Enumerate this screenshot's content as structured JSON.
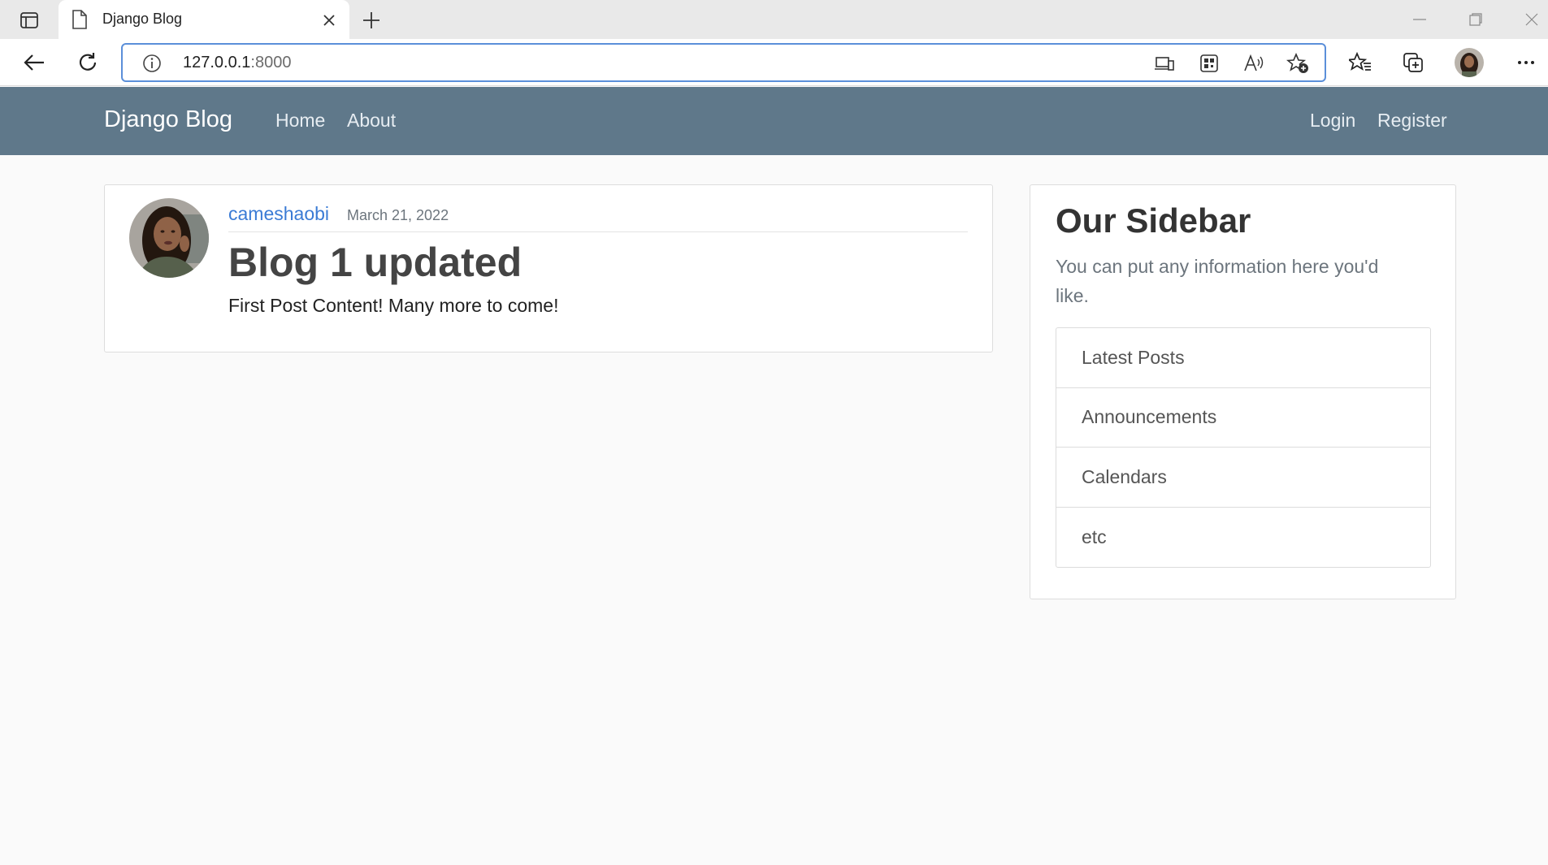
{
  "browser": {
    "tab_title": "Django Blog",
    "url_host": "127.0.0.1",
    "url_port": ":8000",
    "icons": {
      "sidebar": "tab-sidebar-icon",
      "page": "page-icon",
      "close": "close-icon",
      "new_tab": "plus-icon",
      "back": "back-arrow-icon",
      "reload": "reload-icon",
      "info": "info-icon",
      "app_available": "app-available-icon",
      "qr": "qr-code-icon",
      "read_aloud": "read-aloud-icon",
      "add_favorite": "add-favorite-icon",
      "favorites": "favorites-icon",
      "collections": "collections-icon",
      "menu": "more-menu-icon"
    },
    "accent": "#5b8fd9"
  },
  "navbar": {
    "brand": "Django Blog",
    "links_left": [
      "Home",
      "About"
    ],
    "links_right": [
      "Login",
      "Register"
    ],
    "background": "#5f788a"
  },
  "post": {
    "author": "cameshaobi",
    "date": "March 21, 2022",
    "title": "Blog 1 updated",
    "content": "First Post Content! Many more to come!",
    "author_color": "#3a7bd5"
  },
  "sidebar": {
    "title": "Our Sidebar",
    "text": "You can put any information here you'd like.",
    "items": [
      "Latest Posts",
      "Announcements",
      "Calendars",
      "etc"
    ]
  }
}
